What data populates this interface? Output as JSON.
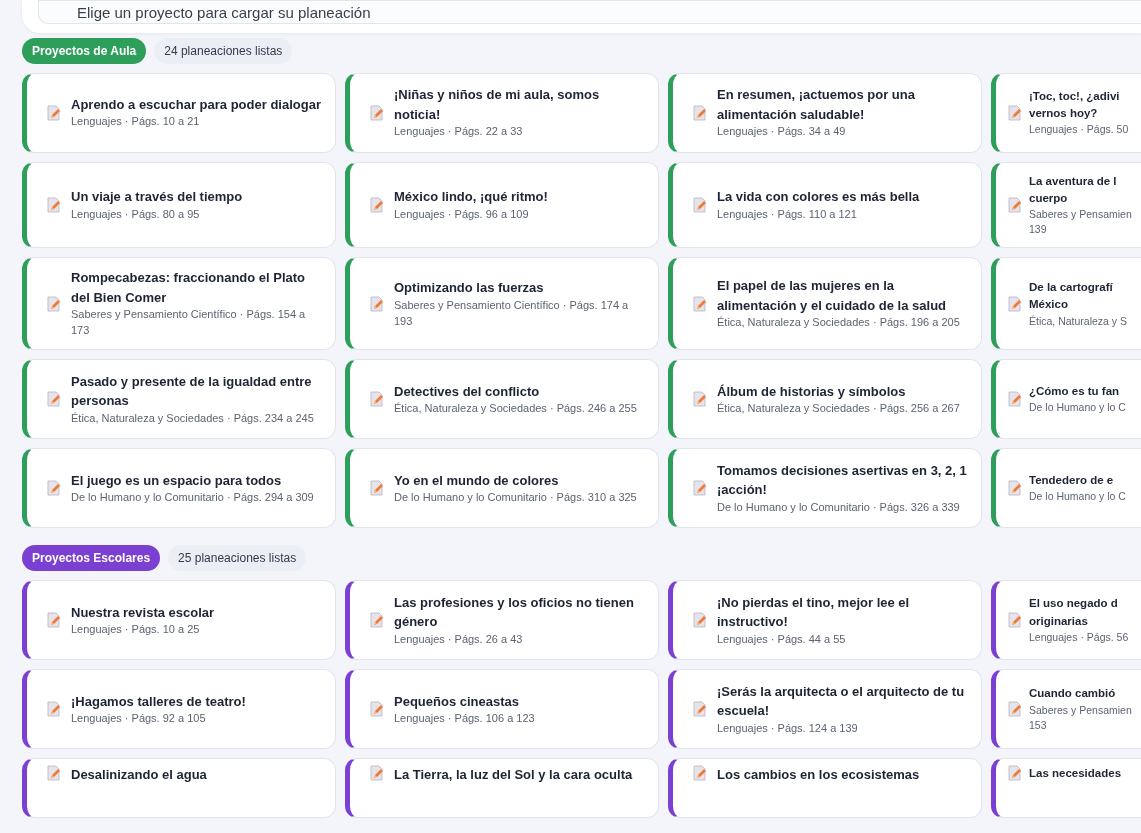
{
  "project_picker": {
    "placeholder": "Elige un proyecto para cargar su planeación"
  },
  "sections": [
    {
      "label": "Proyectos de Aula",
      "count": "24 planeaciones listas",
      "color": "#2e9e5b",
      "cards": [
        {
          "title": "Aprendo a escuchar para poder dialogar",
          "subtitle": "Lenguajes · Págs. 10 a 21"
        },
        {
          "title": "¡Niñas y niños de mi aula, somos noticia!",
          "subtitle": "Lenguajes · Págs. 22 a 33"
        },
        {
          "title": "En resumen, ¡actuemos por una alimentación saludable!",
          "subtitle": "Lenguajes · Págs. 34 a 49"
        },
        {
          "title": "¡Toc, toc!, ¿adivi\nvernos hoy?",
          "subtitle": "Lenguajes · Págs. 50"
        },
        {
          "title": "Un viaje a través del tiempo",
          "subtitle": "Lenguajes · Págs. 80 a 95"
        },
        {
          "title": "México lindo, ¡qué ritmo!",
          "subtitle": "Lenguajes · Págs. 96 a 109"
        },
        {
          "title": "La vida con colores es más bella",
          "subtitle": "Lenguajes · Págs. 110 a 121"
        },
        {
          "title": "La aventura de l\ncuerpo",
          "subtitle": "Saberes y Pensamien\n139"
        },
        {
          "title": "Rompecabezas: fraccionando el Plato del Bien Comer",
          "subtitle": "Saberes y Pensamiento Científico · Págs. 154 a 173"
        },
        {
          "title": "Optimizando las fuerzas",
          "subtitle": "Saberes y Pensamiento Científico · Págs. 174 a 193"
        },
        {
          "title": "El papel de las mujeres en la alimentación y el cuidado de la salud",
          "subtitle": "Ética, Naturaleza y Sociedades · Págs. 196 a 205"
        },
        {
          "title": "De la cartografí\nMéxico",
          "subtitle": "Ética, Naturaleza y S"
        },
        {
          "title": "Pasado y presente de la igualdad entre personas",
          "subtitle": "Ética, Naturaleza y Sociedades · Págs. 234 a 245"
        },
        {
          "title": "Detectives del conflicto",
          "subtitle": "Ética, Naturaleza y Sociedades · Págs. 246 a 255"
        },
        {
          "title": "Álbum de historias y símbolos",
          "subtitle": "Ética, Naturaleza y Sociedades · Págs. 256 a 267"
        },
        {
          "title": "¿Cómo es tu fan",
          "subtitle": "De lo Humano y lo C"
        },
        {
          "title": "El juego es un espacio para todos",
          "subtitle": "De lo Humano y lo Comunitario · Págs. 294 a 309"
        },
        {
          "title": "Yo en el mundo de colores",
          "subtitle": "De lo Humano y lo Comunitario · Págs. 310 a 325"
        },
        {
          "title": "Tomamos decisiones asertivas en 3, 2, 1 ¡acción!",
          "subtitle": "De lo Humano y lo Comunitario · Págs. 326 a 339"
        },
        {
          "title": "Tendedero de e",
          "subtitle": "De lo Humano y lo C"
        }
      ]
    },
    {
      "label": "Proyectos Escolares",
      "count": "25 planeaciones listas",
      "color": "#7b3fd1",
      "cards": [
        {
          "title": "Nuestra revista escolar",
          "subtitle": "Lenguajes · Págs. 10 a 25"
        },
        {
          "title": "Las profesiones y los oficios no tienen género",
          "subtitle": "Lenguajes · Págs. 26 a 43"
        },
        {
          "title": "¡No pierdas el tino, mejor lee el instructivo!",
          "subtitle": "Lenguajes · Págs. 44 a 55"
        },
        {
          "title": "El uso negado d\noriginarias",
          "subtitle": "Lenguajes · Págs. 56"
        },
        {
          "title": "¡Hagamos talleres de teatro!",
          "subtitle": "Lenguajes · Págs. 92 a 105"
        },
        {
          "title": "Pequeños cineastas",
          "subtitle": "Lenguajes · Págs. 106 a 123"
        },
        {
          "title": "¡Serás la arquitecta o el arquitecto de tu escuela!",
          "subtitle": "Lenguajes · Págs. 124 a 139"
        },
        {
          "title": "Cuando cambió",
          "subtitle": "Saberes y Pensamien\n153"
        },
        {
          "title": "Desalinizando el agua"
        },
        {
          "title": "La Tierra, la luz del Sol y la cara oculta"
        },
        {
          "title": "Los cambios en los ecosistemas"
        },
        {
          "title": "Las necesidades"
        }
      ]
    }
  ]
}
